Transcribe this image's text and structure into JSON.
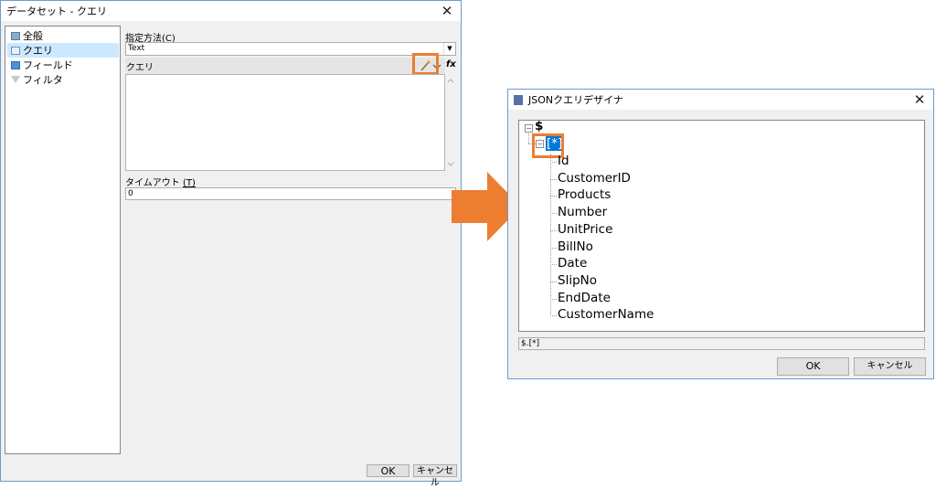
{
  "dataset_dialog": {
    "title": "データセット - クエリ",
    "nav": [
      {
        "label": "全般",
        "icon": "general-icon",
        "selected": false
      },
      {
        "label": "クエリ",
        "icon": "query-icon",
        "selected": true
      },
      {
        "label": "フィールド",
        "icon": "fields-icon",
        "selected": false
      },
      {
        "label": "フィルタ",
        "icon": "filter-icon",
        "selected": false
      }
    ],
    "method_label": "指定方法",
    "method_accel": "(C)",
    "method_value": "Text",
    "query_label": "クエリ",
    "query_value": "",
    "timeout_label": "タイムアウト",
    "timeout_accel": "(T)",
    "timeout_value": "0",
    "ok_label": "OK",
    "cancel_label": "キャンセル"
  },
  "json_designer": {
    "title": "JSONクエリデザイナ",
    "root_label": "$",
    "array_label": "[*]",
    "fields": [
      "Id",
      "CustomerID",
      "Products",
      "Number",
      "UnitPrice",
      "BillNo",
      "Date",
      "SlipNo",
      "EndDate",
      "CustomerName"
    ],
    "path_value": "$.[*]",
    "ok_label": "OK",
    "cancel_label": "キャンセル"
  },
  "colors": {
    "highlight": "#ed7d31",
    "selection": "#0078d7",
    "nav_selected": "#cce8ff"
  }
}
